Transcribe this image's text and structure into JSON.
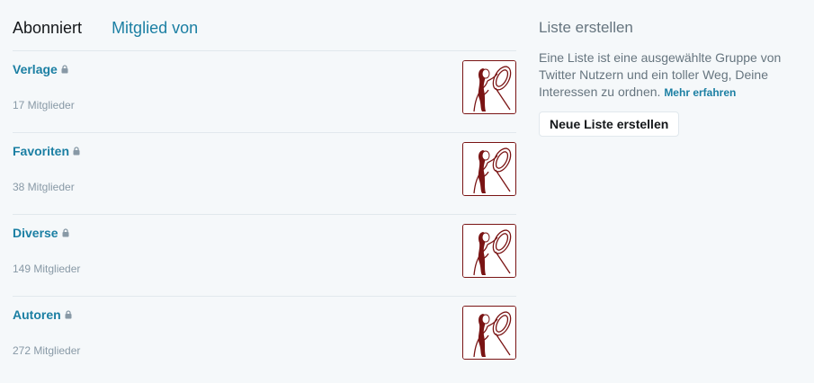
{
  "tabs": {
    "subscribed": "Abonniert",
    "member_of": "Mitglied von"
  },
  "lists": [
    {
      "name": "Verlage",
      "members": "17 Mitglieder"
    },
    {
      "name": "Favoriten",
      "members": "38 Mitglieder"
    },
    {
      "name": "Diverse",
      "members": "149 Mitglieder"
    },
    {
      "name": "Autoren",
      "members": "272 Mitglieder"
    }
  ],
  "sidebar": {
    "title": "Liste erstellen",
    "description": "Eine Liste ist eine ausgewählte Gruppe von Twitter Nutzern und ein toller Weg, Deine Interessen zu ordnen.",
    "learn_more": "Mehr erfahren",
    "create_button": "Neue Liste erstellen"
  },
  "colors": {
    "link": "#1b7fa3",
    "avatar_line": "#7a1414"
  }
}
